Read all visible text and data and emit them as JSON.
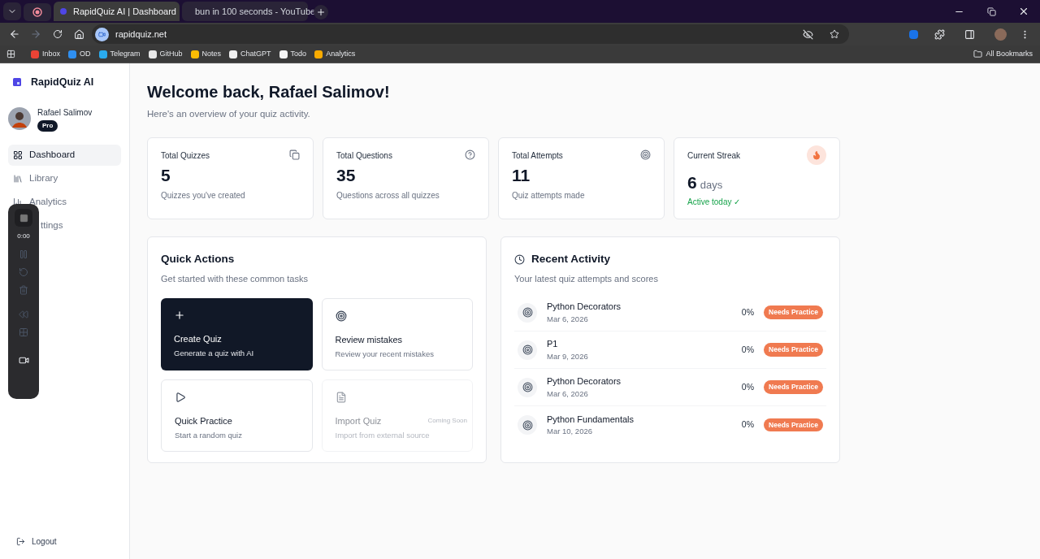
{
  "browser": {
    "tabs": [
      {
        "kind": "pinned",
        "selected": false
      },
      {
        "kind": "page",
        "title": "RapidQuiz AI | Dashboard",
        "selected": true
      },
      {
        "kind": "video",
        "title": "bun in 100 seconds - YouTube",
        "selected": false
      }
    ],
    "url": "rapidquiz.net",
    "bookmarks": [
      {
        "label": "Inbox",
        "color": "#ea4335"
      },
      {
        "label": "OD",
        "color": "#2f8ff0"
      },
      {
        "label": "Telegram",
        "color": "#2aabee"
      },
      {
        "label": "GitHub",
        "color": "#e8e8e8"
      },
      {
        "label": "Notes",
        "color": "#fbbc04"
      },
      {
        "label": "ChatGPT",
        "color": "#f0f0f0"
      },
      {
        "label": "Todo",
        "color": "#f5f5f5"
      },
      {
        "label": "Analytics",
        "color": "#f9ab00"
      }
    ],
    "all_bookmarks": "All Bookmarks"
  },
  "sidebar": {
    "brand": "RapidQuiz AI",
    "user": {
      "name": "Rafael Salimov",
      "badge": "Pro"
    },
    "nav": [
      {
        "kind": "dashboard",
        "label": "Dashboard",
        "selected": true
      },
      {
        "kind": "library",
        "label": "Library",
        "selected": false
      },
      {
        "kind": "analytics",
        "label": "Analytics",
        "selected": false
      },
      {
        "kind": "covered",
        "label": "ttings",
        "selected": false
      }
    ],
    "logout": "Logout"
  },
  "recorder": {
    "time": "0:00"
  },
  "header": {
    "title": "Welcome back, Rafael Salimov!",
    "subtitle": "Here's an overview of your quiz activity."
  },
  "stats": [
    {
      "kind": "quizzes",
      "label": "Total Quizzes",
      "value": "5",
      "caption": "Quizzes you've created"
    },
    {
      "kind": "questions",
      "label": "Total Questions",
      "value": "35",
      "caption": "Questions across all quizzes"
    },
    {
      "kind": "attempts",
      "label": "Total Attempts",
      "value": "11",
      "caption": "Quiz attempts made"
    },
    {
      "kind": "streak",
      "label": "Current Streak",
      "value": "6",
      "unit": "days",
      "caption": "Active today ✓"
    }
  ],
  "quick_actions": {
    "title": "Quick Actions",
    "subtitle": "Get started with these common tasks",
    "actions": [
      {
        "kind": "create",
        "title": "Create Quiz",
        "description": "Generate a quiz with AI",
        "disabled": false
      },
      {
        "kind": "review",
        "title": "Review mistakes",
        "description": "Review your recent mistakes",
        "disabled": false
      },
      {
        "kind": "practice",
        "title": "Quick Practice",
        "description": "Start a random quiz",
        "disabled": false
      },
      {
        "kind": "import",
        "title": "Import Quiz",
        "description": "Import from external source",
        "badge": "Coming Soon",
        "disabled": true
      }
    ]
  },
  "recent": {
    "title": "Recent Activity",
    "subtitle": "Your latest quiz attempts and scores",
    "items": [
      {
        "name": "Python Decorators",
        "date": "Mar 6, 2026",
        "score": "0%",
        "status": "Needs Practice"
      },
      {
        "name": "P1",
        "date": "Mar 9, 2026",
        "score": "0%",
        "status": "Needs Practice"
      },
      {
        "name": "Python Decorators",
        "date": "Mar 6, 2026",
        "score": "0%",
        "status": "Needs Practice"
      },
      {
        "name": "Python Fundamentals",
        "date": "Mar 10, 2026",
        "score": "0%",
        "status": "Needs Practice"
      }
    ]
  }
}
